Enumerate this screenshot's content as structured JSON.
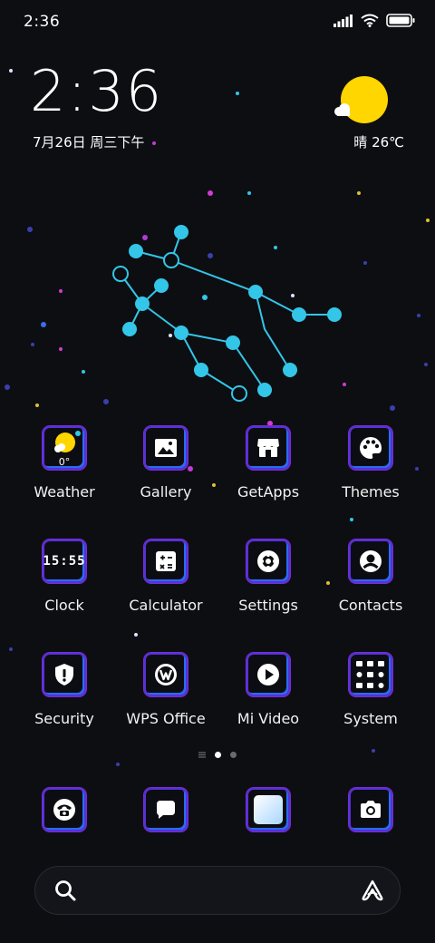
{
  "status_bar": {
    "time": "2:36",
    "icons": [
      "signal-icon",
      "wifi-icon",
      "battery-icon"
    ]
  },
  "clock_widget": {
    "time": "2:36",
    "date": "7月26日 周三下午"
  },
  "weather_widget": {
    "condition_icon": "sun-cloud-icon",
    "text": "晴 26℃"
  },
  "apps": [
    {
      "label": "Weather",
      "icon": "weather-icon",
      "badge": "0°"
    },
    {
      "label": "Gallery",
      "icon": "image-icon"
    },
    {
      "label": "GetApps",
      "icon": "store-icon"
    },
    {
      "label": "Themes",
      "icon": "palette-icon"
    },
    {
      "label": "Clock",
      "icon": "clock-icon",
      "badge": "15:55"
    },
    {
      "label": "Calculator",
      "icon": "calculator-icon"
    },
    {
      "label": "Settings",
      "icon": "gear-icon"
    },
    {
      "label": "Contacts",
      "icon": "contact-icon"
    },
    {
      "label": "Security",
      "icon": "shield-icon"
    },
    {
      "label": "WPS Office",
      "icon": "wps-icon"
    },
    {
      "label": "Mi Video",
      "icon": "play-icon"
    },
    {
      "label": "System",
      "icon": "folder-icon"
    }
  ],
  "page_indicator": {
    "pages": 2,
    "current": 1
  },
  "dock": [
    {
      "icon": "phone-icon"
    },
    {
      "icon": "message-icon"
    },
    {
      "icon": "browser-icon"
    },
    {
      "icon": "camera-icon"
    }
  ],
  "search": {
    "left_icon": "search-icon",
    "right_icon": "assistant-icon"
  },
  "colors": {
    "background": "#0d0e12",
    "constellation": "#33c6e8",
    "sun": "#ffd600",
    "icon_border": "#5432d8"
  }
}
